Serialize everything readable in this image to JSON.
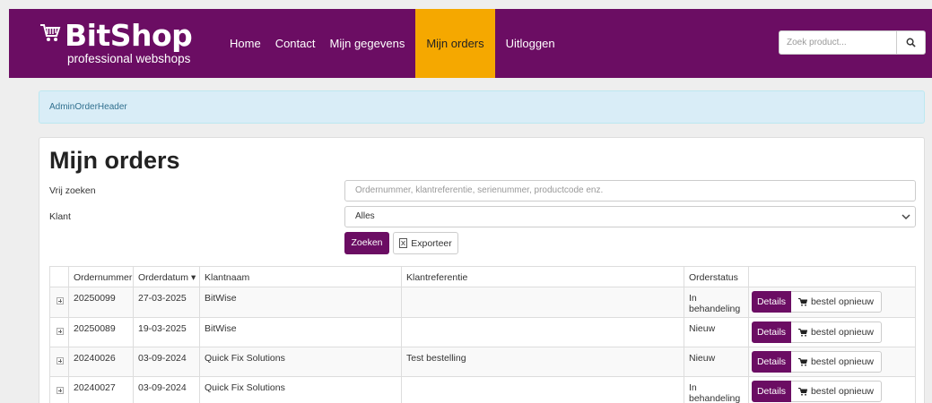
{
  "brand": {
    "title": "BitShop",
    "subtitle": "professional webshops"
  },
  "nav": {
    "items": [
      {
        "label": "Home",
        "active": false
      },
      {
        "label": "Contact",
        "active": false
      },
      {
        "label": "Mijn gegevens",
        "active": false
      },
      {
        "label": "Mijn orders",
        "active": true
      },
      {
        "label": "Uitloggen",
        "active": false
      }
    ]
  },
  "search": {
    "placeholder": "Zoek product...",
    "icon": "search-icon"
  },
  "alert": {
    "text": "AdminOrderHeader"
  },
  "page": {
    "title": "Mijn orders"
  },
  "filters": {
    "free_search_label": "Vrij zoeken",
    "free_search_placeholder": "Ordernummer, klantreferentie, serienummer, productcode enz.",
    "customer_label": "Klant",
    "customer_value": "Alles",
    "search_button": "Zoeken",
    "export_button": "Exporteer"
  },
  "table": {
    "headers": [
      "",
      "Ordernummer",
      "Orderdatum",
      "Klantnaam",
      "Klantreferentie",
      "Orderstatus",
      ""
    ],
    "sort_indicator": "▾",
    "rows": [
      {
        "ordernummer": "20250099",
        "orderdatum": "27-03-2025",
        "klantnaam": "BitWise",
        "klantreferentie": "",
        "orderstatus": "In behandeling"
      },
      {
        "ordernummer": "20250089",
        "orderdatum": "19-03-2025",
        "klantnaam": "BitWise",
        "klantreferentie": "",
        "orderstatus": "Nieuw"
      },
      {
        "ordernummer": "20240026",
        "orderdatum": "03-09-2024",
        "klantnaam": "Quick Fix Solutions",
        "klantreferentie": "Test bestelling",
        "orderstatus": "Nieuw"
      },
      {
        "ordernummer": "20240027",
        "orderdatum": "03-09-2024",
        "klantnaam": "Quick Fix Solutions",
        "klantreferentie": "",
        "orderstatus": "In behandeling"
      }
    ],
    "details_label": "Details",
    "reorder_label": "bestel opnieuw"
  },
  "colors": {
    "brand": "#6b0d63",
    "accent": "#f5a800",
    "info_bg": "#d9edf7"
  }
}
